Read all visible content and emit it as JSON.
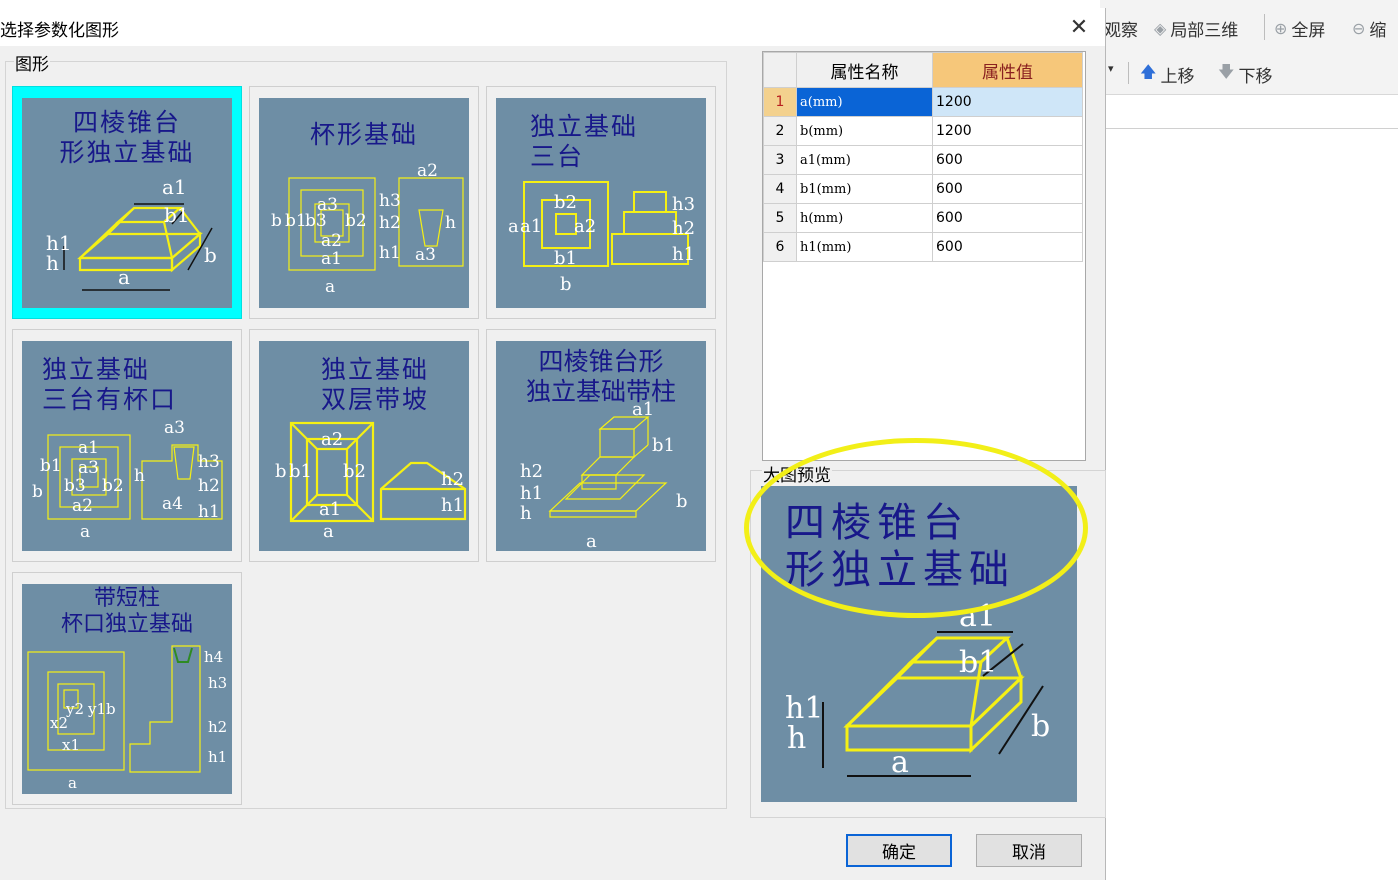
{
  "dialog": {
    "title": "选择参数化图形",
    "group_label": "图形",
    "preview_label": "大图预览",
    "ok_label": "确定",
    "cancel_label": "取消"
  },
  "background_toolbar": {
    "row1": [
      {
        "icon": "eye-icon",
        "label": "观察"
      },
      {
        "icon": "cube-icon",
        "label": "局部三维"
      },
      {
        "icon": "zoom-in-icon",
        "label": "全屏"
      },
      {
        "icon": "zoom-out-icon",
        "label": "缩"
      }
    ],
    "row2": [
      {
        "icon": "arrow-up-icon",
        "label": "上移"
      },
      {
        "icon": "arrow-down-icon",
        "label": "下移"
      }
    ]
  },
  "shapes": [
    {
      "title": "四棱锥台\n形独立基础",
      "labels": [
        "a1",
        "b1",
        "h1",
        "h",
        "a",
        "b"
      ]
    },
    {
      "title": "杯形基础",
      "labels": [
        "a2",
        "a3",
        "b",
        "b1",
        "b3",
        "b2",
        "a2",
        "a1",
        "a",
        "h3",
        "h2",
        "h1",
        "a3",
        "h"
      ]
    },
    {
      "title": "独立基础\n三台",
      "labels": [
        "b2",
        "a",
        "a1",
        "a2",
        "b1",
        "b",
        "h3",
        "h2",
        "h1"
      ]
    },
    {
      "title": "独立基础\n三台有杯口",
      "labels": [
        "a1",
        "a3",
        "a3",
        "b1",
        "b3",
        "b2",
        "b",
        "a2",
        "a",
        "h",
        "a4",
        "h3",
        "h2",
        "h1"
      ]
    },
    {
      "title": "独立基础\n双层带坡",
      "labels": [
        "a2",
        "b",
        "b1",
        "b2",
        "a1",
        "a",
        "h2",
        "h1"
      ]
    },
    {
      "title": "四棱锥台形\n独立基础带柱",
      "labels": [
        "a1",
        "b1",
        "h2",
        "h1",
        "h",
        "b",
        "a"
      ]
    },
    {
      "title": "带短柱\n杯口独立基础",
      "labels": [
        "x2",
        "y2",
        "y1",
        "b",
        "x1",
        "a",
        "h4",
        "h3",
        "h2",
        "h1"
      ]
    }
  ],
  "grid": {
    "headers": {
      "name": "属性名称",
      "value": "属性值"
    },
    "rows": [
      {
        "num": "1",
        "name": "a(mm)",
        "value": "1200"
      },
      {
        "num": "2",
        "name": "b(mm)",
        "value": "1200"
      },
      {
        "num": "3",
        "name": "a1(mm)",
        "value": "600"
      },
      {
        "num": "4",
        "name": "b1(mm)",
        "value": "600"
      },
      {
        "num": "5",
        "name": "h(mm)",
        "value": "600"
      },
      {
        "num": "6",
        "name": "h1(mm)",
        "value": "600"
      }
    ]
  },
  "preview": {
    "title": "四棱锥台\n形独立基础",
    "labels": [
      "a1",
      "b1",
      "h1",
      "h",
      "a",
      "b"
    ]
  },
  "colors": {
    "tile_bg": "#6e8ea5",
    "selected_tile": "#00ffff",
    "annotation": "#f2ef18",
    "line_yellow": "#f5f014"
  }
}
